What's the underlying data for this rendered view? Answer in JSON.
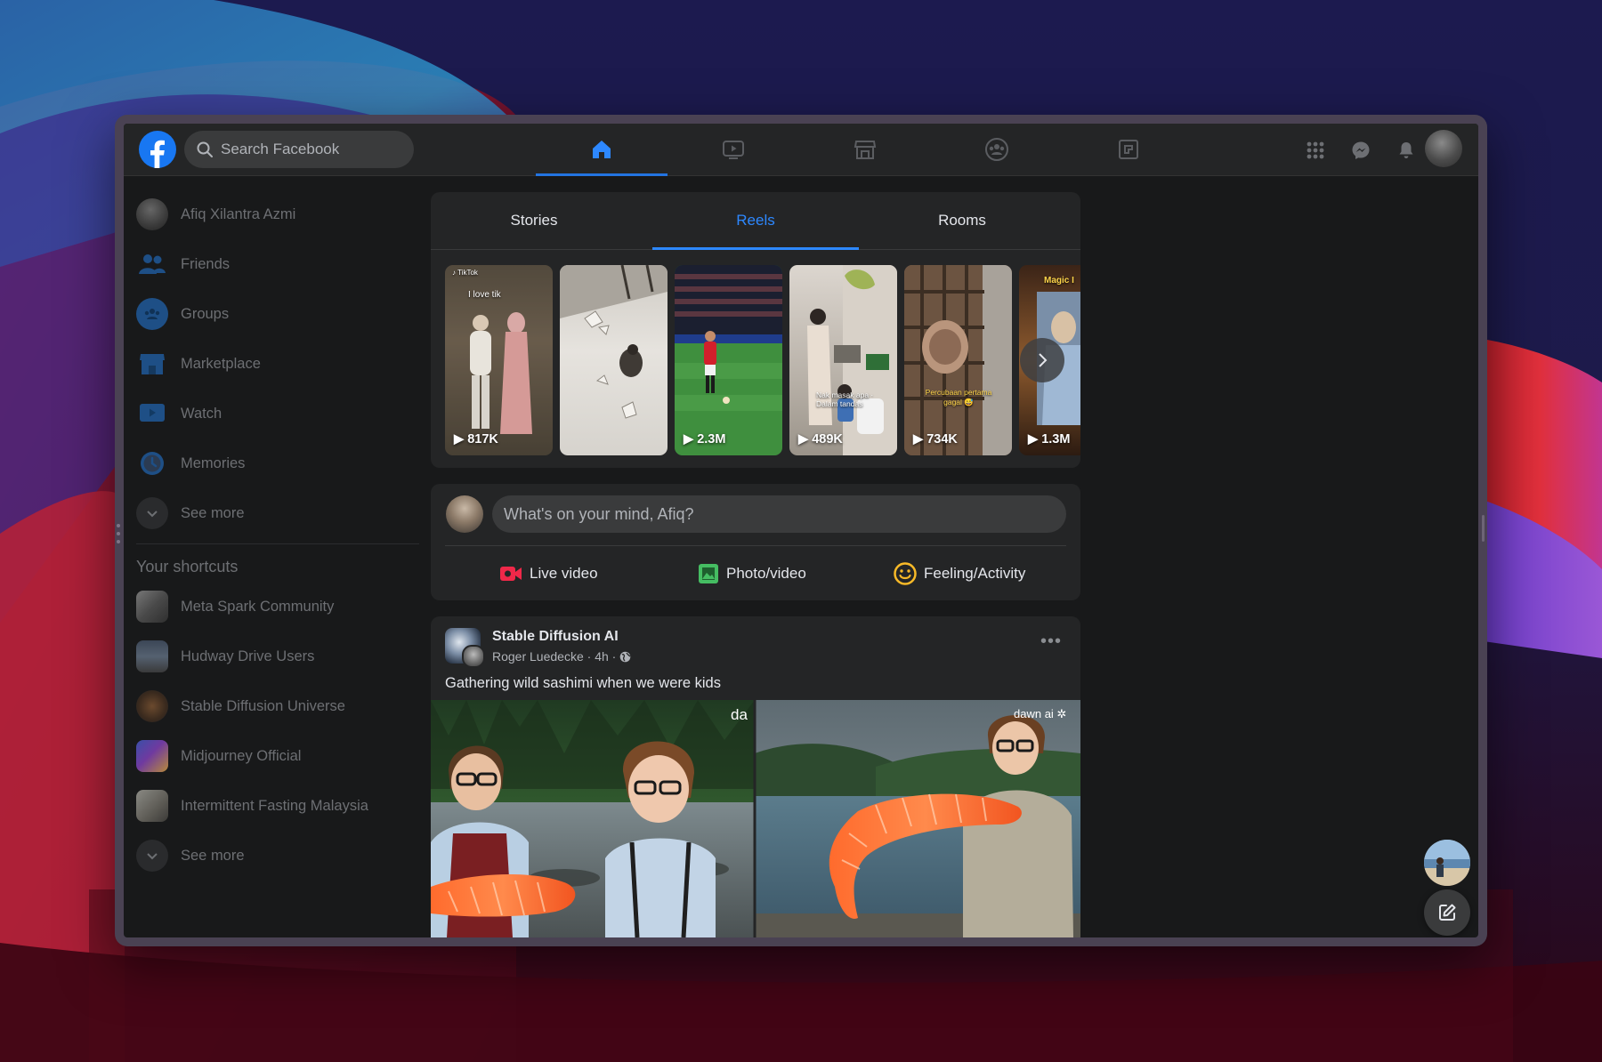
{
  "header": {
    "search_placeholder": "Search Facebook",
    "nav": [
      "home-icon",
      "watch-icon",
      "marketplace-icon",
      "groups-icon",
      "gaming-icon"
    ],
    "active_nav": "home-icon",
    "right_icons": [
      "menu-grid-icon",
      "messenger-icon",
      "notifications-icon",
      "account-avatar"
    ]
  },
  "sidebar": {
    "items": [
      {
        "label": "Afiq Xilantra Azmi",
        "icon": "profile-avatar"
      },
      {
        "label": "Friends",
        "icon": "friends-icon"
      },
      {
        "label": "Groups",
        "icon": "groups-icon"
      },
      {
        "label": "Marketplace",
        "icon": "marketplace-icon"
      },
      {
        "label": "Watch",
        "icon": "watch-icon"
      },
      {
        "label": "Memories",
        "icon": "memories-icon"
      },
      {
        "label": "See more",
        "icon": "chevron-down-icon"
      }
    ],
    "shortcuts_heading": "Your shortcuts",
    "shortcuts": [
      {
        "label": "Meta Spark Community"
      },
      {
        "label": "Hudway Drive Users"
      },
      {
        "label": "Stable Diffusion Universe"
      },
      {
        "label": "Midjourney Official"
      },
      {
        "label": "Intermittent Fasting Malaysia"
      },
      {
        "label": "See more"
      }
    ]
  },
  "reels": {
    "tabs": [
      "Stories",
      "Reels",
      "Rooms"
    ],
    "active_tab": "Reels",
    "items": [
      {
        "views": "817K",
        "overlay": "I love tik"
      },
      {
        "views": ""
      },
      {
        "views": "2.3M"
      },
      {
        "views": "489K",
        "overlay": "Nak masak apa · Dalam tandas"
      },
      {
        "views": "734K",
        "overlay": "Percubaan pertama gagal 😅"
      },
      {
        "views": "1.3M",
        "overlay": "Magic I"
      }
    ]
  },
  "composer": {
    "placeholder": "What's on your mind, Afiq?",
    "actions": [
      "Live video",
      "Photo/video",
      "Feeling/Activity"
    ]
  },
  "post": {
    "page_name": "Stable Diffusion AI",
    "author": "Roger Luedecke",
    "time": "4h",
    "caption": "Gathering wild sashimi when we were kids",
    "watermark_left": "da",
    "watermark_right": "dawn ai"
  },
  "colors": {
    "accent": "#2d88ff",
    "surface": "#242526",
    "background": "#18191a",
    "text": "#e4e6eb",
    "muted": "#b0b3b8"
  }
}
